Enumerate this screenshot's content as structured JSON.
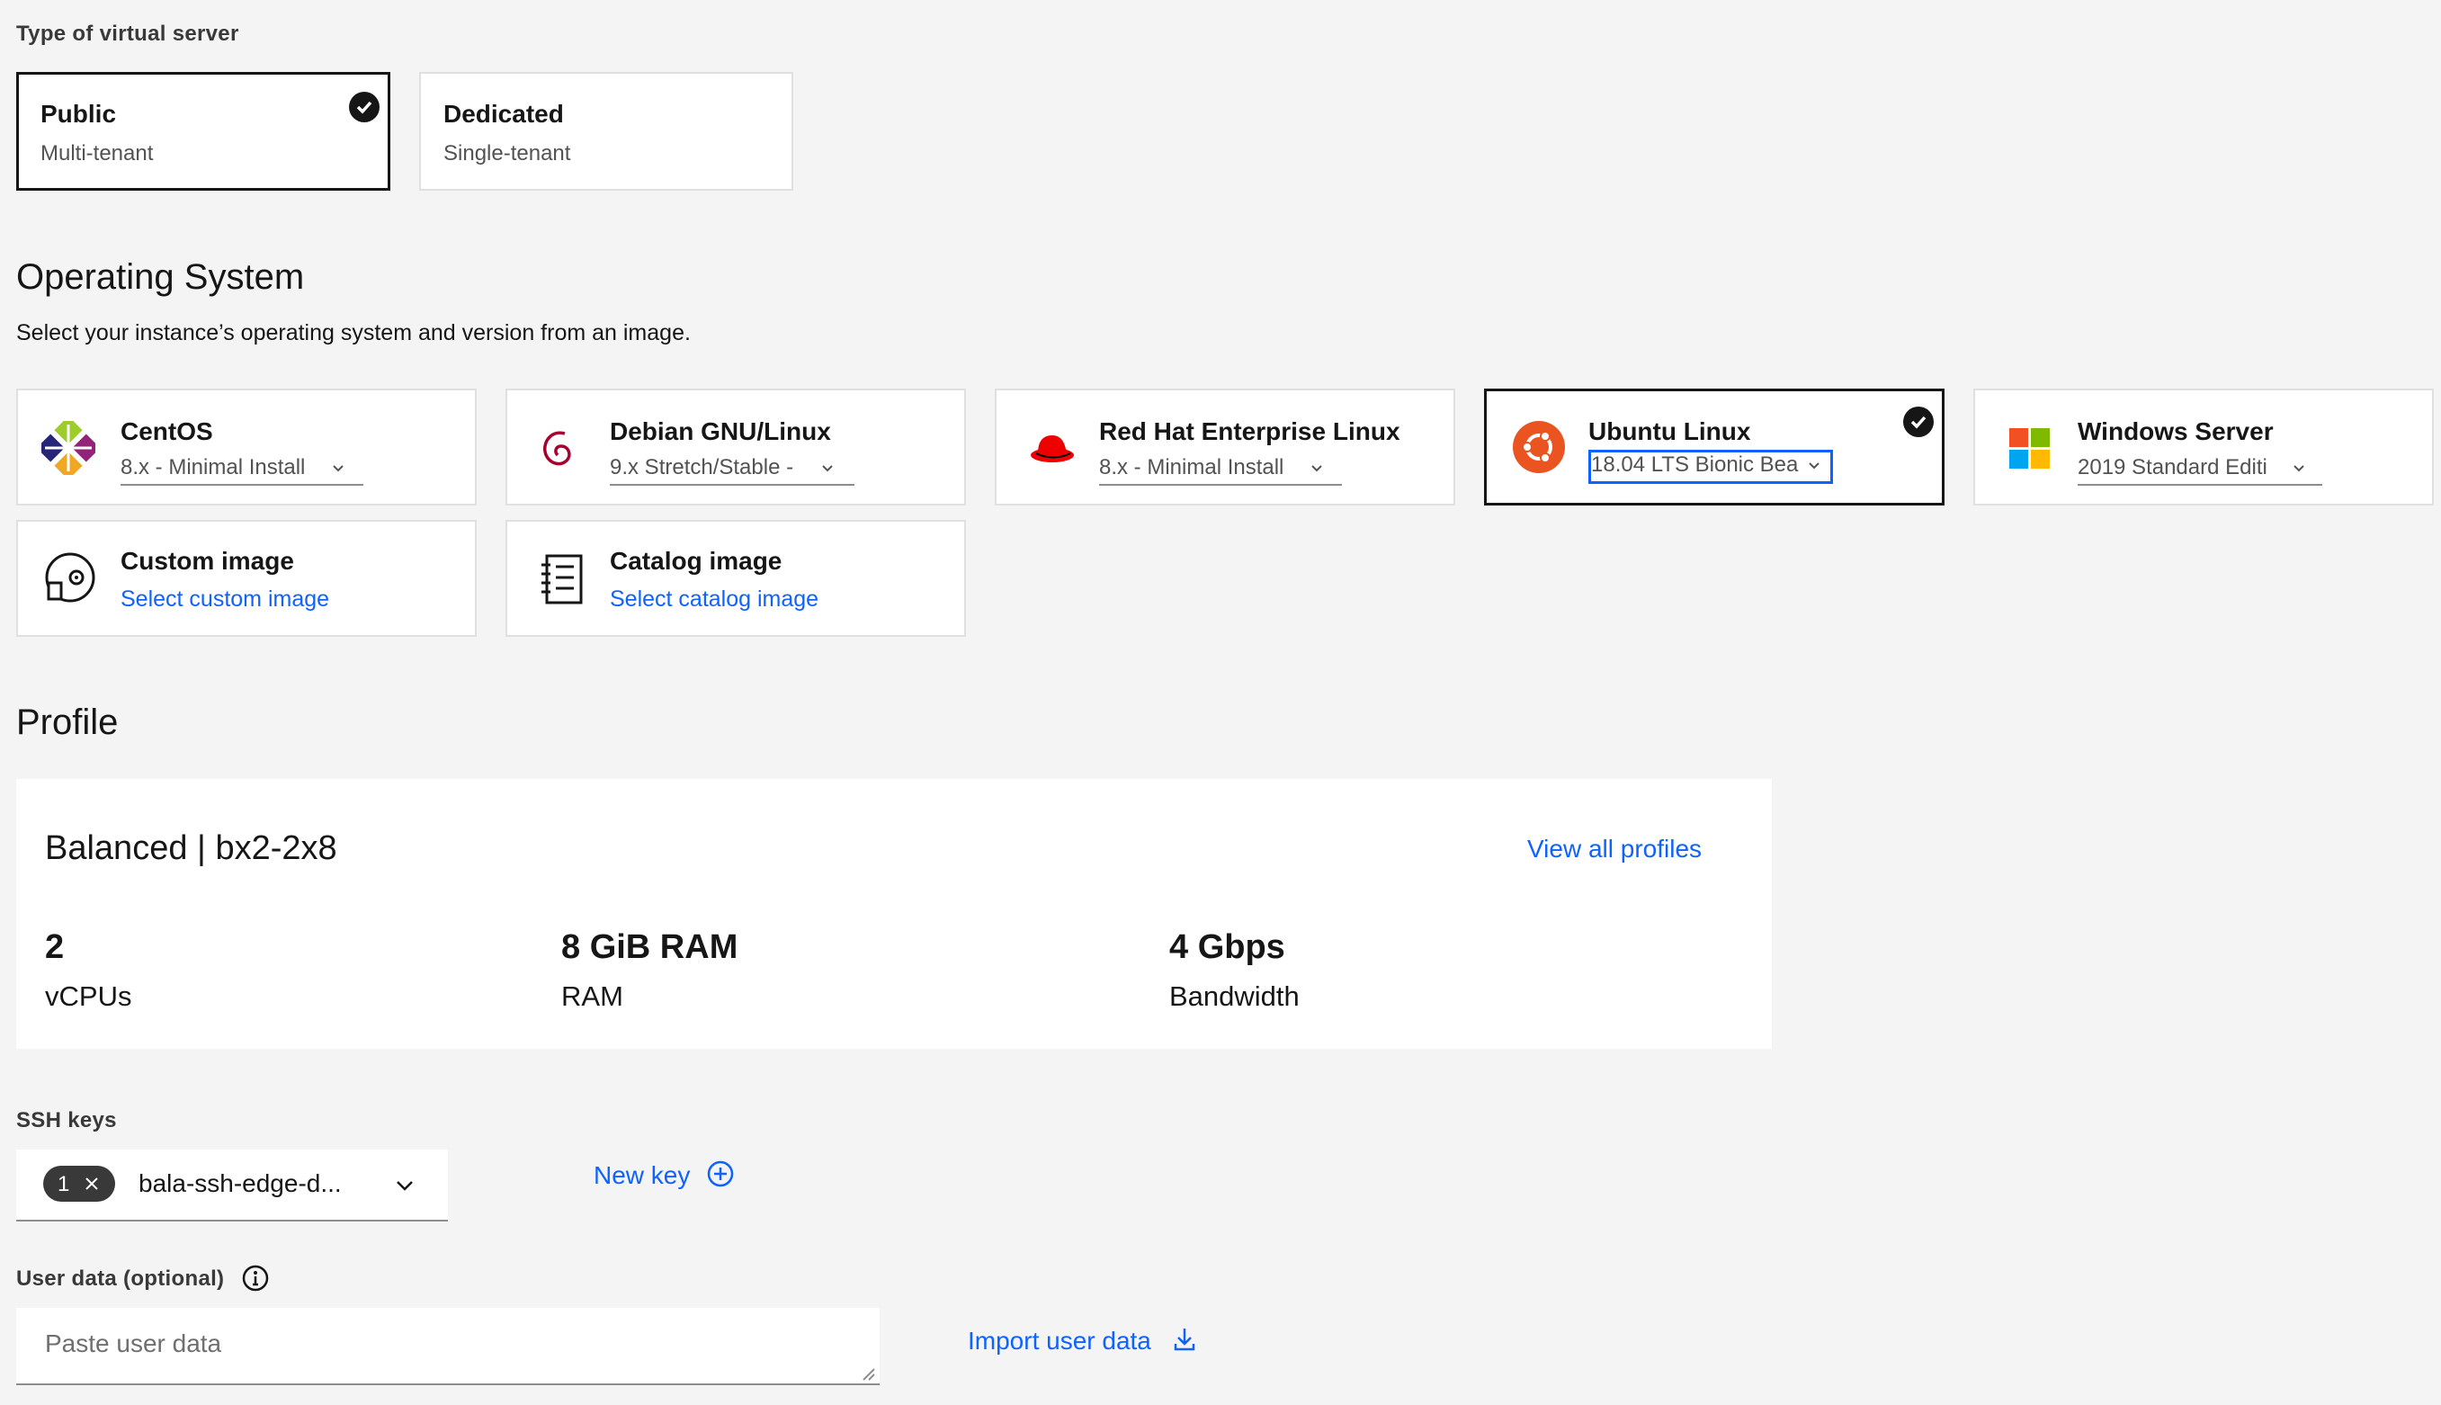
{
  "server_type": {
    "label": "Type of virtual server",
    "options": [
      {
        "title": "Public",
        "subtitle": "Multi-tenant",
        "selected": true
      },
      {
        "title": "Dedicated",
        "subtitle": "Single-tenant",
        "selected": false
      }
    ]
  },
  "os": {
    "heading": "Operating System",
    "helper": "Select your instance’s operating system and version from an image.",
    "options": [
      {
        "title": "CentOS",
        "version": "8.x - Minimal Install",
        "icon": "centos-logo-icon",
        "selected": false
      },
      {
        "title": "Debian GNU/Linux",
        "version": "9.x Stretch/Stable -",
        "icon": "debian-logo-icon",
        "selected": false
      },
      {
        "title": "Red Hat Enterprise Linux",
        "version": "8.x - Minimal Install",
        "icon": "redhat-logo-icon",
        "selected": false
      },
      {
        "title": "Ubuntu Linux",
        "version": "18.04 LTS Bionic Bea",
        "icon": "ubuntu-logo-icon",
        "selected": true
      },
      {
        "title": "Windows Server",
        "version": "2019 Standard Editi",
        "icon": "windows-logo-icon",
        "selected": false
      }
    ],
    "custom": {
      "title": "Custom image",
      "link": "Select custom image",
      "icon": "disc-icon"
    },
    "catalog": {
      "title": "Catalog image",
      "link": "Select catalog image",
      "icon": "catalog-icon"
    }
  },
  "profile": {
    "heading": "Profile",
    "name": "Balanced | bx2-2x8",
    "view_all": "View all profiles",
    "specs": [
      {
        "value": "2",
        "label": "vCPUs"
      },
      {
        "value": "8 GiB RAM",
        "label": "RAM"
      },
      {
        "value": "4 Gbps",
        "label": "Bandwidth"
      }
    ]
  },
  "ssh": {
    "label": "SSH keys",
    "count": "1",
    "value": "bala-ssh-edge-d...",
    "new_key": "New key"
  },
  "user_data": {
    "label": "User data (optional)",
    "placeholder": "Paste user data",
    "import": "Import user data"
  },
  "colors": {
    "accent": "#0f62fe",
    "ubuntu": "#e95420",
    "redhat": "#ee0000",
    "debian": "#a80030"
  }
}
